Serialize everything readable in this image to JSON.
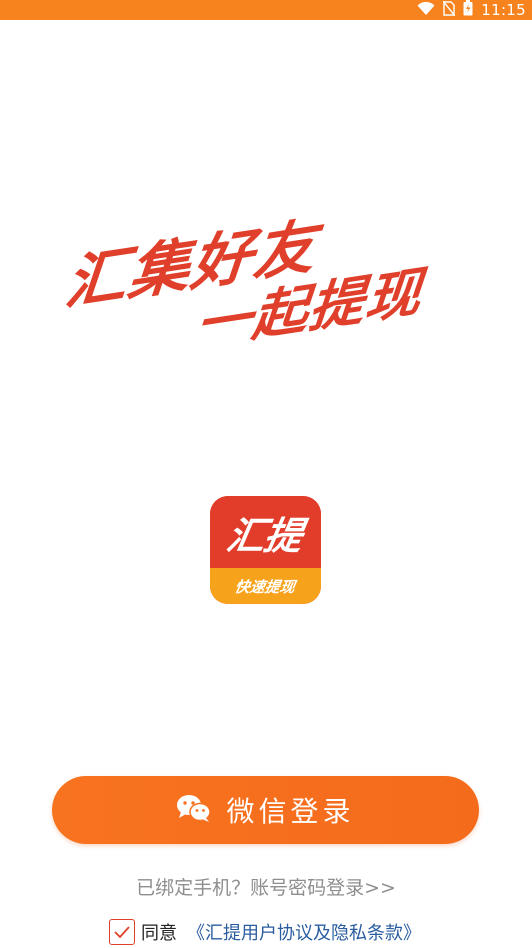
{
  "status_bar": {
    "time": "11:15",
    "icons": [
      "wifi-icon",
      "no-sim-icon",
      "battery-charging-icon"
    ]
  },
  "slogan": {
    "line1": "汇集好友",
    "line2": "一起提现"
  },
  "logo": {
    "title": "汇提",
    "subtitle": "快速提现"
  },
  "login": {
    "wechat_label": "微信登录",
    "wechat_icon": "wechat-icon",
    "alt_login": "已绑定手机？账号密码登录>>"
  },
  "agreement": {
    "checked": true,
    "prefix": "同意",
    "link": "《汇提用户协议及隐私条款》"
  },
  "colors": {
    "accent": "#f8731f",
    "brand_red": "#e0402b",
    "brand_yellow": "#f7a21b",
    "link": "#2a5d9f"
  }
}
